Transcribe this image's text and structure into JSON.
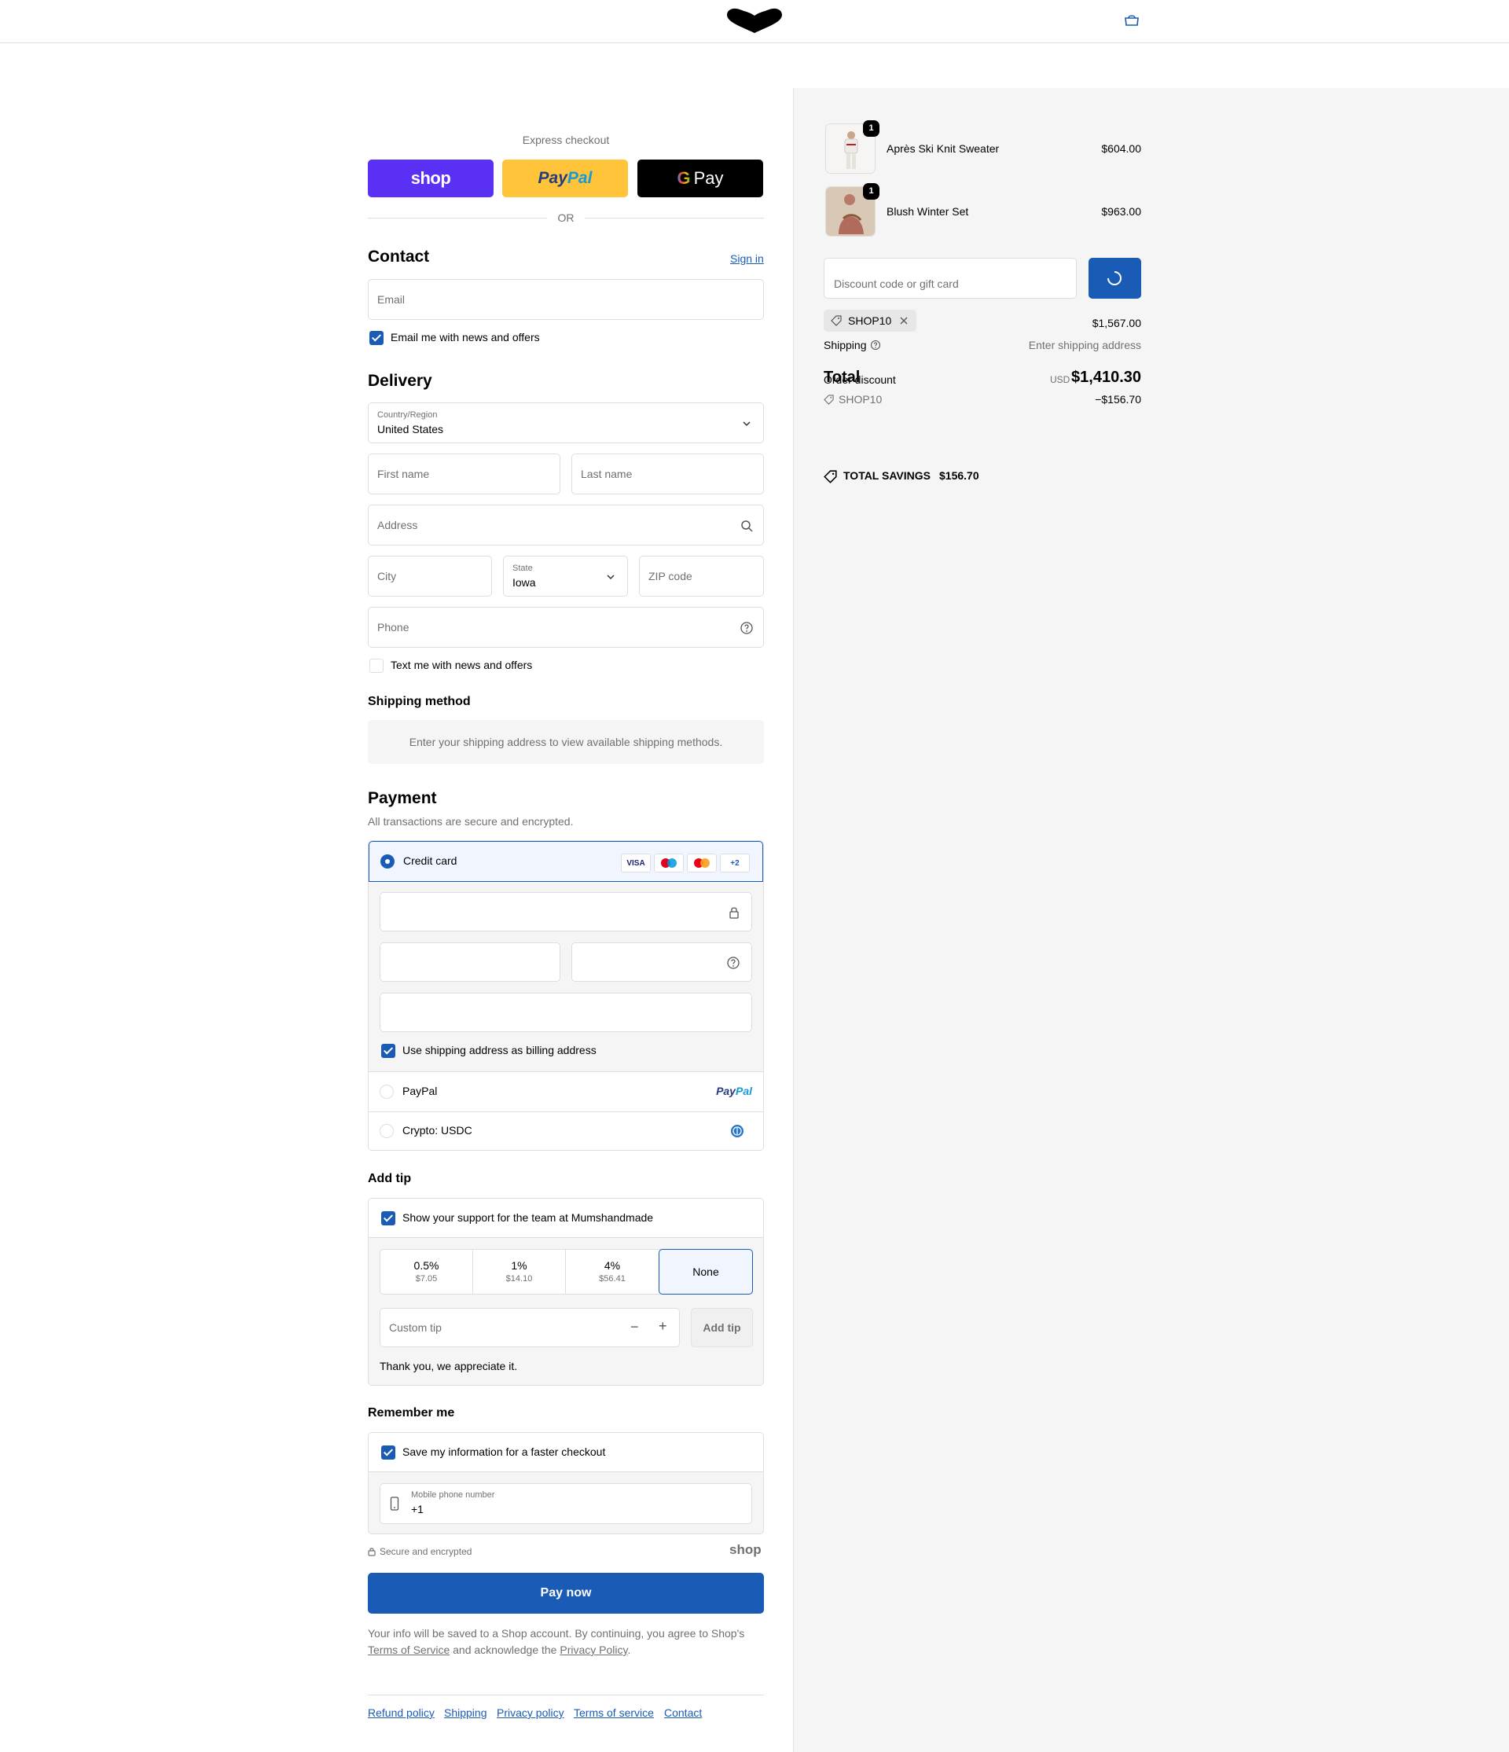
{
  "header": {
    "logo_icon": "heart-logo-icon",
    "cart_icon": "shopping-bag-icon"
  },
  "express": {
    "label": "Express checkout",
    "shop_label": "shop",
    "paypal_part1": "Pay",
    "paypal_part2": "Pal",
    "gpay_g": "G",
    "gpay_label": "Pay",
    "or": "OR"
  },
  "contact": {
    "title": "Contact",
    "sign_in": "Sign in",
    "email_placeholder": "Email",
    "email_news": "Email me with news and offers",
    "email_news_checked": true
  },
  "delivery": {
    "title": "Delivery",
    "country_label": "Country/Region",
    "country_value": "United States",
    "first_name": "First name",
    "last_name": "Last name",
    "address": "Address",
    "city": "City",
    "state_label": "State",
    "state_value": "Iowa",
    "zip": "ZIP code",
    "phone": "Phone",
    "text_news": "Text me with news and offers",
    "text_news_checked": false
  },
  "shipping_method": {
    "title": "Shipping method",
    "message": "Enter your shipping address to view available shipping methods."
  },
  "payment": {
    "title": "Payment",
    "subtitle": "All transactions are secure and encrypted.",
    "credit_card": "Credit card",
    "card_logos": [
      "VISA",
      "maestro",
      "mastercard",
      "+2"
    ],
    "billing_same": "Use shipping address as billing address",
    "paypal": "PayPal",
    "paypal_logo_1": "Pay",
    "paypal_logo_2": "Pal",
    "crypto": "Crypto: USDC"
  },
  "tip": {
    "title": "Add tip",
    "support": "Show your support for the team at Mumshandmade",
    "options": [
      {
        "pct": "0.5%",
        "amt": "$7.05"
      },
      {
        "pct": "1%",
        "amt": "$14.10"
      },
      {
        "pct": "4%",
        "amt": "$56.41"
      }
    ],
    "none": "None",
    "custom_placeholder": "Custom tip",
    "minus": "−",
    "plus": "+",
    "add_tip": "Add tip",
    "thanks": "Thank you, we appreciate it."
  },
  "remember": {
    "title": "Remember me",
    "save": "Save my information for a faster checkout",
    "phone_label": "Mobile phone number",
    "phone_value": "+1"
  },
  "secure": {
    "label": "Secure and encrypted",
    "shop": "shop"
  },
  "pay_now": "Pay now",
  "legal": {
    "text1": "Your info will be saved to a Shop account. By continuing, you agree to Shop's",
    "tos": "Terms of Service",
    "text2": "and acknowledge the",
    "privacy": "Privacy Policy",
    "text3": "."
  },
  "footer": [
    "Refund policy",
    "Shipping",
    "Privacy policy",
    "Terms of service",
    "Contact"
  ],
  "summary": {
    "items": [
      {
        "name": "Après Ski Knit Sweater",
        "price": "$604.00",
        "qty": "1"
      },
      {
        "name": "Blush Winter Set",
        "price": "$963.00",
        "qty": "1"
      }
    ],
    "discount_placeholder": "Discount code or gift card",
    "code": "SHOP10",
    "subtotal": "$1,567.00",
    "shipping_label": "Shipping",
    "shipping_value": "Enter shipping address",
    "total_label": "Total",
    "order_discount": "Order discount",
    "currency": "USD",
    "total": "$1,410.30",
    "discount_code": "SHOP10",
    "discount_amount": "−$156.70",
    "savings_label": "TOTAL SAVINGS",
    "savings": "$156.70"
  }
}
